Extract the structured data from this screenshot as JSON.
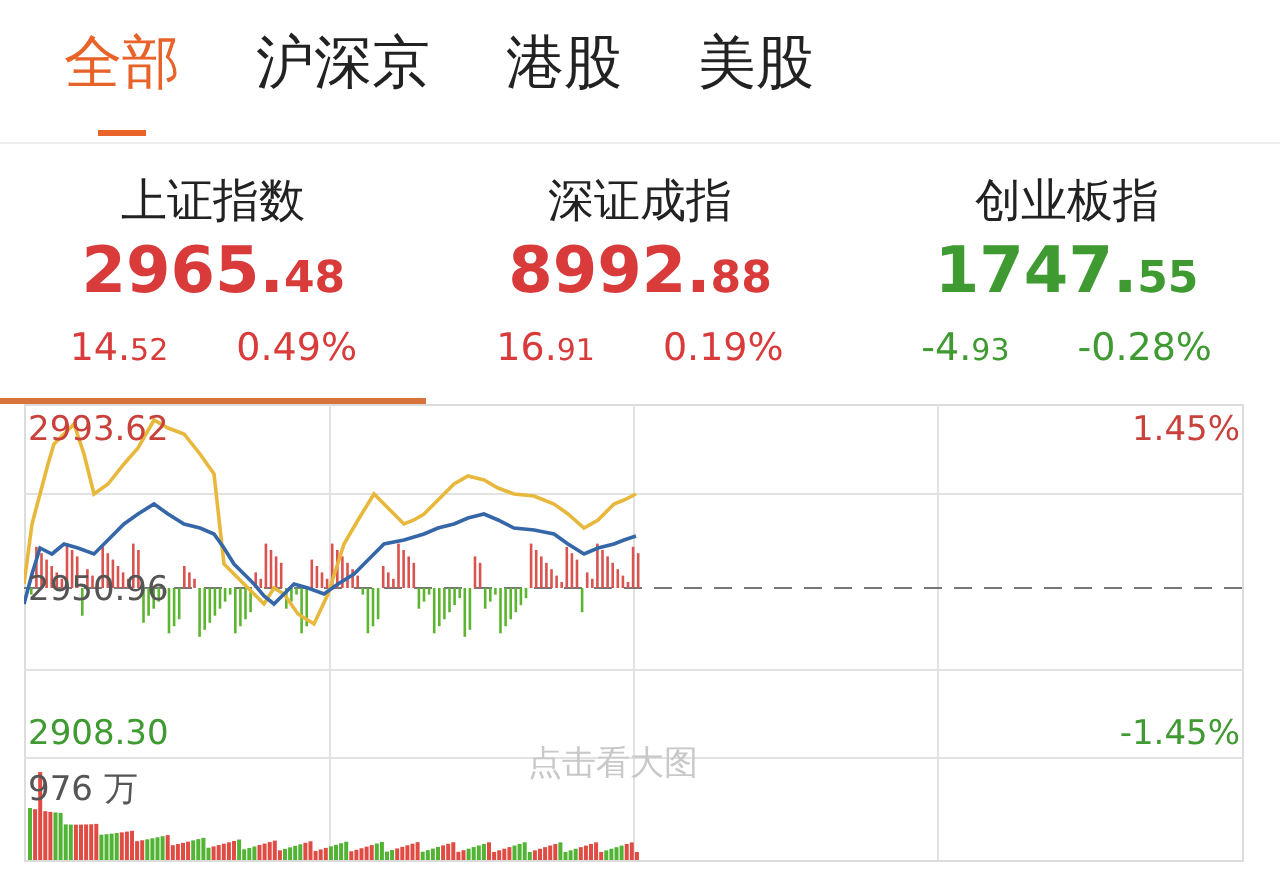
{
  "tabs": [
    {
      "label": "全部",
      "selected": true
    },
    {
      "label": "沪深京",
      "selected": false
    },
    {
      "label": "港股",
      "selected": false
    },
    {
      "label": "美股",
      "selected": false
    }
  ],
  "indices": [
    {
      "name": "上证指数",
      "value": "2965.48",
      "change": "14.52",
      "percent": "0.49%",
      "color": "#d93a3a",
      "selected": true
    },
    {
      "name": "深证成指",
      "value": "8992.88",
      "change": "16.91",
      "percent": "0.19%",
      "color": "#d93a3a",
      "selected": false
    },
    {
      "name": "创业板指",
      "value": "1747.55",
      "change": "-4.93",
      "percent": "-0.28%",
      "color": "#3f9a32",
      "selected": false
    }
  ],
  "chart": {
    "high": "2993.62",
    "high_percent": "1.45%",
    "base": "2950.96",
    "low": "2908.30",
    "low_percent": "-1.45%",
    "volume": "976 万",
    "hint": "点击看大图"
  }
}
